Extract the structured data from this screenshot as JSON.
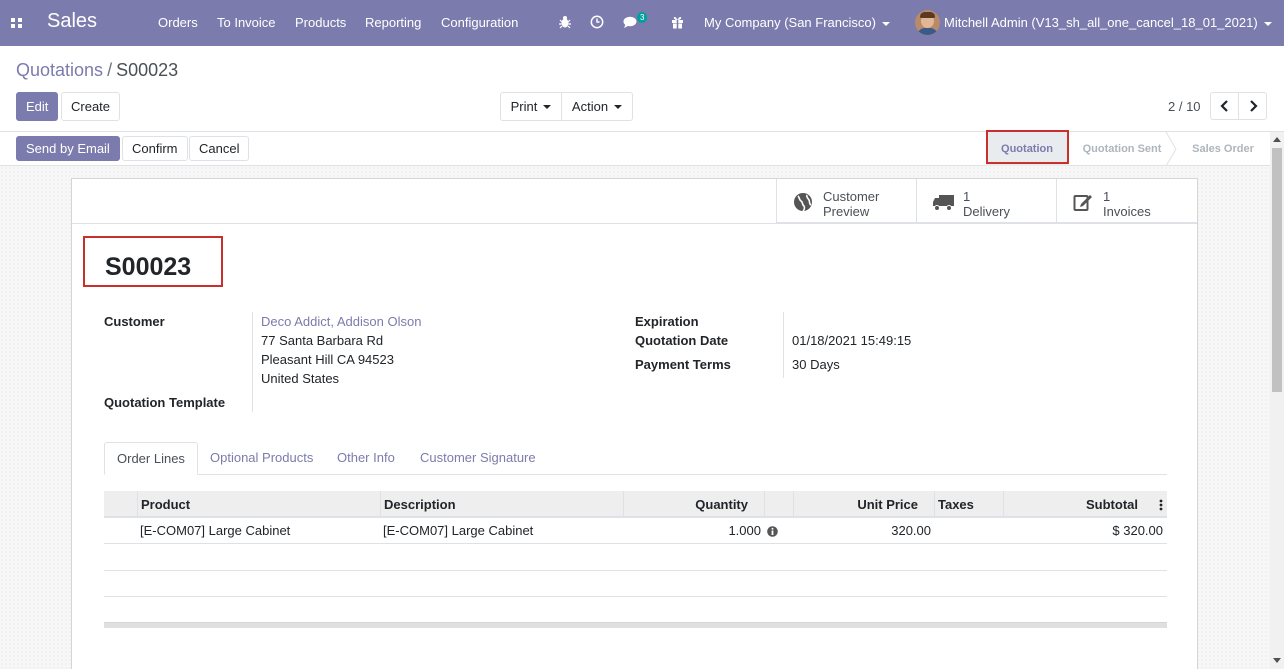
{
  "navbar": {
    "app_title": "Sales",
    "menu": [
      "Orders",
      "To Invoice",
      "Products",
      "Reporting",
      "Configuration"
    ],
    "chat_count": "3",
    "company": "My Company (San Francisco)",
    "user": "Mitchell Admin (V13_sh_all_one_cancel_18_01_2021)",
    "bg_color": "#7c7bad"
  },
  "breadcrumb": {
    "parent": "Quotations",
    "separator": "/",
    "current": "S00023"
  },
  "toolbar": {
    "edit_label": "Edit",
    "create_label": "Create",
    "print_label": "Print",
    "action_label": "Action",
    "pager": "2 / 10"
  },
  "actions": {
    "send_email_label": "Send by Email",
    "confirm_label": "Confirm",
    "cancel_label": "Cancel"
  },
  "statusbar": {
    "steps": [
      "Quotation",
      "Quotation Sent",
      "Sales Order"
    ],
    "active": "Quotation"
  },
  "smart_buttons": {
    "preview_line1": "Customer",
    "preview_line2": "Preview",
    "delivery_count": "1",
    "delivery_label": "Delivery",
    "invoices_count": "1",
    "invoices_label": "Invoices"
  },
  "form": {
    "name": "S00023",
    "customer_label": "Customer",
    "customer_name": "Deco Addict, Addison Olson",
    "address_line1": "77 Santa Barbara Rd",
    "address_line2": "Pleasant Hill CA 94523",
    "address_line3": "United States",
    "template_label": "Quotation Template",
    "expiration_label": "Expiration",
    "quotation_date_label": "Quotation Date",
    "quotation_date": "01/18/2021 15:49:15",
    "payment_terms_label": "Payment Terms",
    "payment_terms": "30 Days"
  },
  "tabs": [
    "Order Lines",
    "Optional Products",
    "Other Info",
    "Customer Signature"
  ],
  "order_lines": {
    "headers": {
      "product": "Product",
      "description": "Description",
      "quantity": "Quantity",
      "unit_price": "Unit Price",
      "taxes": "Taxes",
      "subtotal": "Subtotal"
    },
    "rows": [
      {
        "product": "[E-COM07] Large Cabinet",
        "description": "[E-COM07] Large Cabinet",
        "quantity": "1.000",
        "unit_price": "320.00",
        "taxes": "",
        "subtotal": "$ 320.00"
      }
    ]
  }
}
